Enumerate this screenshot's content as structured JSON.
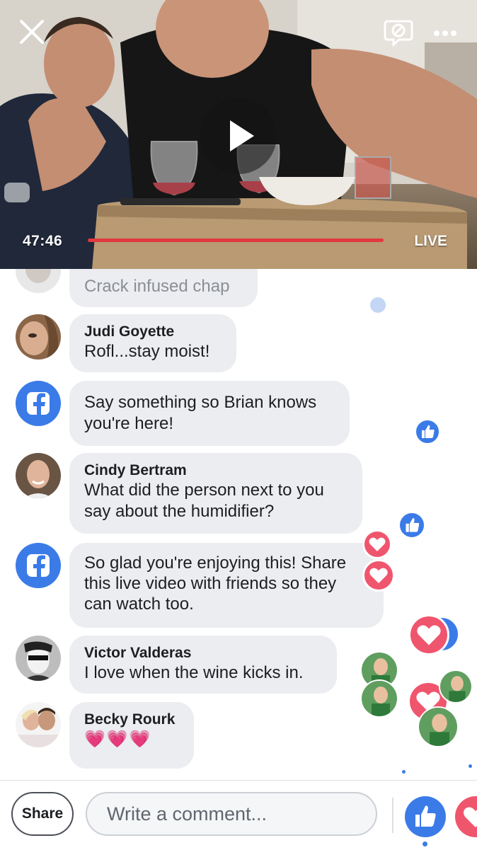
{
  "video": {
    "timestamp": "47:46",
    "live_label": "LIVE",
    "progress_fraction": 0.85
  },
  "comments": [
    {
      "name": "",
      "text": "Crack infused chap",
      "avatar": "user-photo"
    },
    {
      "name": "Judi Goyette",
      "text": "Rofl...stay moist!",
      "avatar": "user-photo"
    },
    {
      "name": "",
      "text": "Say something so Brian knows you're here!",
      "avatar": "facebook-logo"
    },
    {
      "name": "Cindy Bertram",
      "text": "What did the person next to you say about the humidifier?",
      "avatar": "user-photo"
    },
    {
      "name": "",
      "text": "So glad you're enjoying this! Share this live video with friends so they can watch too.",
      "avatar": "facebook-logo"
    },
    {
      "name": "Victor Valderas",
      "text": "I love when the wine kicks in.",
      "avatar": "user-photo"
    },
    {
      "name": "Becky Rourk",
      "text": "💗💗💗",
      "avatar": "user-photo"
    }
  ],
  "bottom_bar": {
    "share_label": "Share",
    "comment_placeholder": "Write a comment..."
  },
  "icons": {
    "close": "close-icon",
    "stop_sharing": "video-stop-icon",
    "more": "more-icon",
    "play": "play-icon",
    "like": "like-icon",
    "love": "heart-icon"
  },
  "colors": {
    "facebook_blue": "#3b7be8",
    "love_pink": "#f0556e",
    "progress_red": "#e0393e",
    "bubble_gray": "#ebedf0"
  }
}
